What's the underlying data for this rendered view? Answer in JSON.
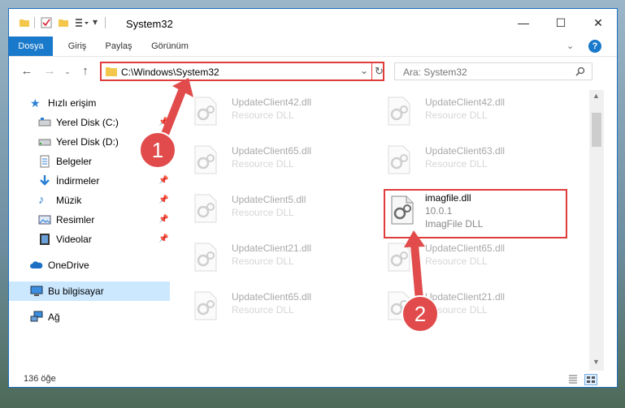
{
  "window": {
    "title": "System32",
    "controls": {
      "minimize": "—",
      "maximize": "☐",
      "close": "✕"
    }
  },
  "ribbon": {
    "tabs": [
      "Dosya",
      "Giriş",
      "Paylaş",
      "Görünüm"
    ],
    "help": "?"
  },
  "address": {
    "path": "C:\\Windows\\System32",
    "search_placeholder": "Ara: System32"
  },
  "sidebar": {
    "items": [
      {
        "label": "Hızlı erişim",
        "icon": "star-icon",
        "pinned": false
      },
      {
        "label": "Yerel Disk (C:)",
        "icon": "drive-icon",
        "pinned": true
      },
      {
        "label": "Yerel Disk (D:)",
        "icon": "drive-icon",
        "pinned": true
      },
      {
        "label": "Belgeler",
        "icon": "document-icon",
        "pinned": true
      },
      {
        "label": "İndirmeler",
        "icon": "download-icon",
        "pinned": true
      },
      {
        "label": "Müzik",
        "icon": "music-icon",
        "pinned": true
      },
      {
        "label": "Resimler",
        "icon": "pictures-icon",
        "pinned": true
      },
      {
        "label": "Videolar",
        "icon": "video-icon",
        "pinned": true
      },
      {
        "label": "OneDrive",
        "icon": "cloud-icon",
        "pinned": false
      },
      {
        "label": "Bu bilgisayar",
        "icon": "computer-icon",
        "pinned": false
      },
      {
        "label": "Ağ",
        "icon": "network-icon",
        "pinned": false
      }
    ]
  },
  "files": [
    {
      "name": "UpdateClient42.dll",
      "desc": "Resource DLL",
      "faded": true
    },
    {
      "name": "UpdateClient42.dll",
      "desc": "Resource DLL",
      "faded": true
    },
    {
      "name": "UpdateClient65.dll",
      "desc": "Resource DLL",
      "faded": true
    },
    {
      "name": "UpdateClient63.dll",
      "desc": "Resource DLL",
      "faded": true
    },
    {
      "name": "UpdateClient5.dll",
      "desc": "Resource DLL",
      "faded": true
    },
    {
      "name": "imagfile.dll",
      "version": "10.0.1",
      "desc": "ImagFile DLL",
      "faded": false
    },
    {
      "name": "UpdateClient21.dll",
      "desc": "Resource DLL",
      "faded": true
    },
    {
      "name": "UpdateClient65.dll",
      "desc": "Resource DLL",
      "faded": true
    },
    {
      "name": "UpdateClient65.dll",
      "desc": "Resource DLL",
      "faded": true
    },
    {
      "name": "UpdateClient21.dll",
      "desc": "Resource DLL",
      "faded": true
    }
  ],
  "status": {
    "count": "136 öğe"
  },
  "callouts": [
    "1",
    "2"
  ],
  "colors": {
    "accent": "#1979ca",
    "highlight": "#e03c3c",
    "selection": "#cce8ff"
  }
}
